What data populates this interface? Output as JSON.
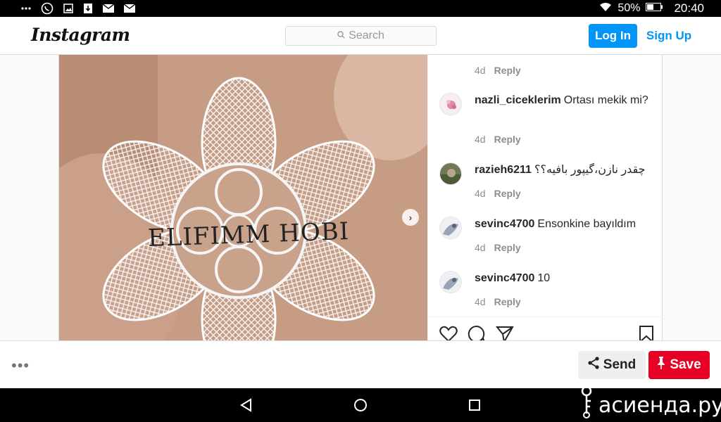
{
  "statusbar": {
    "left_icons": [
      "more-dots-icon",
      "viber-icon",
      "gallery-icon",
      "download-icon",
      "mail-icon",
      "mail-icon"
    ],
    "battery": "50%",
    "time": "20:40"
  },
  "header": {
    "logo": "Instagram",
    "search_placeholder": "Search",
    "login_label": "Log In",
    "signup_label": "Sign Up",
    "accent": "#0095f6"
  },
  "post": {
    "photo_caption": "ELIFIMM HOBI",
    "top_meta": {
      "age": "4d",
      "reply": "Reply"
    },
    "comments": [
      {
        "user": "nazli_ciceklerim",
        "text": "Ortası mekik mi?",
        "age": "4d",
        "reply": "Reply"
      },
      {
        "user": "razieh6211",
        "text": "چقدر نازن،گیپور بافیه؟؟",
        "age": "4d",
        "reply": "Reply"
      },
      {
        "user": "sevinc4700",
        "text": "Ensonkine bayıldım",
        "age": "4d",
        "reply": "Reply"
      },
      {
        "user": "sevinc4700",
        "text": "10",
        "age": "4d",
        "reply": "Reply"
      }
    ]
  },
  "bottombar": {
    "more": "•••",
    "send_label": "Send",
    "save_label": "Save",
    "save_color": "#e60023"
  },
  "watermark": "асиенда.ру"
}
